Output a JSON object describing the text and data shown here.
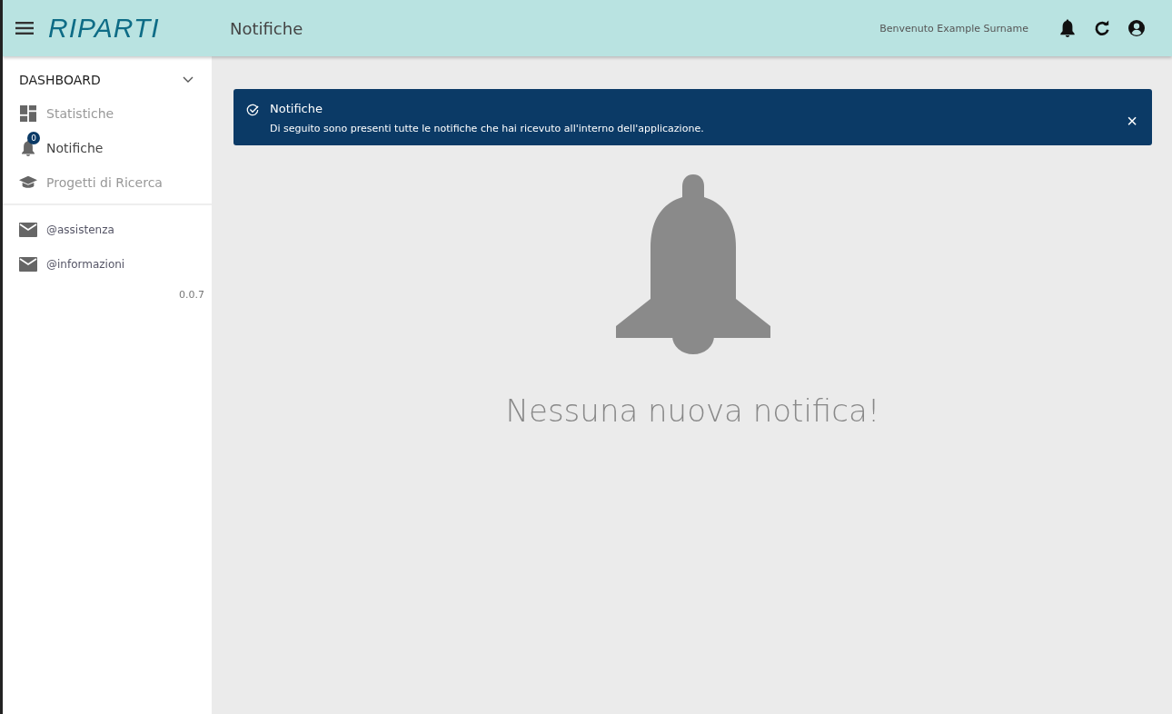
{
  "header": {
    "logo": "RIPARTI",
    "page_title": "Notifiche",
    "welcome": "Benvenuto Example Surname"
  },
  "sidebar": {
    "section": "DASHBOARD",
    "expanded": true,
    "items": [
      {
        "kind": "grid",
        "label": "Statistiche",
        "selected": false
      },
      {
        "kind": "bell",
        "label": "Notifiche",
        "selected": true,
        "badge": "0"
      },
      {
        "kind": "cap",
        "label": "Progetti di Ricerca",
        "selected": false
      }
    ],
    "links": [
      {
        "label": "@assistenza"
      },
      {
        "label": "@informazioni"
      }
    ],
    "version": "0.0.7"
  },
  "banner": {
    "title": "Notifiche",
    "text": "Di seguito sono presenti tutte le notifiche che hai ricevuto all'interno dell'applicazione.",
    "close": "×"
  },
  "empty_state": {
    "message": "Nessuna nuova notifica!"
  }
}
